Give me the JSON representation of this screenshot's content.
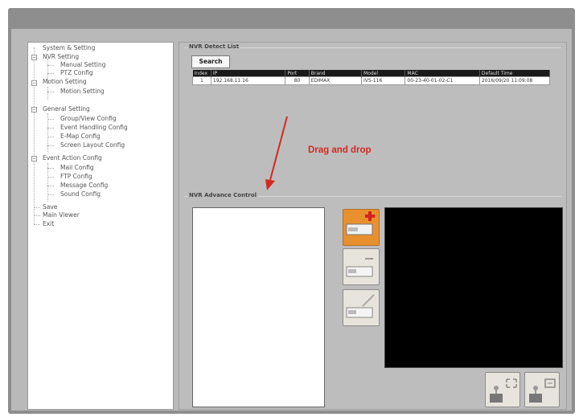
{
  "sidebar": {
    "items": [
      {
        "label": "System & Setting"
      },
      {
        "label": "NVR Setting"
      },
      {
        "label": "Manual Setting"
      },
      {
        "label": "PTZ Config"
      },
      {
        "label": "Motion Setting"
      },
      {
        "label": "Motion Setting"
      },
      {
        "label": "General Setting"
      },
      {
        "label": "Group/View Config"
      },
      {
        "label": "Event Handling Config"
      },
      {
        "label": "E-Map Config"
      },
      {
        "label": "Screen Layout Config"
      },
      {
        "label": "Event Action Config"
      },
      {
        "label": "Mail Config"
      },
      {
        "label": "FTP Config"
      },
      {
        "label": "Message Config"
      },
      {
        "label": "Sound Config"
      },
      {
        "label": "Save"
      },
      {
        "label": "Main Viewer"
      },
      {
        "label": "Exit"
      }
    ]
  },
  "detect": {
    "group_title": "NVR Detect List",
    "search_label": "Search",
    "columns": [
      "Index",
      "IP",
      "Port",
      "Brand",
      "Model",
      "MAC",
      "Default Time"
    ],
    "rows": [
      [
        "1",
        "192.168.11.16",
        "80",
        "EDIMAX",
        "IVS-116",
        "00-23-40-01-02-C1",
        "2016/09/20 11:09:08"
      ]
    ]
  },
  "advanced": {
    "group_title": "NVR Advance Control"
  },
  "annotation": {
    "label": "Drag and drop",
    "color": "#d22a22"
  },
  "icons": {
    "add": "add-nvr-icon",
    "remove": "remove-nvr-icon",
    "edit": "edit-nvr-icon",
    "fullscreen": "fullscreen-icon",
    "snapshot": "snapshot-icon"
  },
  "colors": {
    "accent": "#e8902e",
    "video_bg": "#000000"
  }
}
